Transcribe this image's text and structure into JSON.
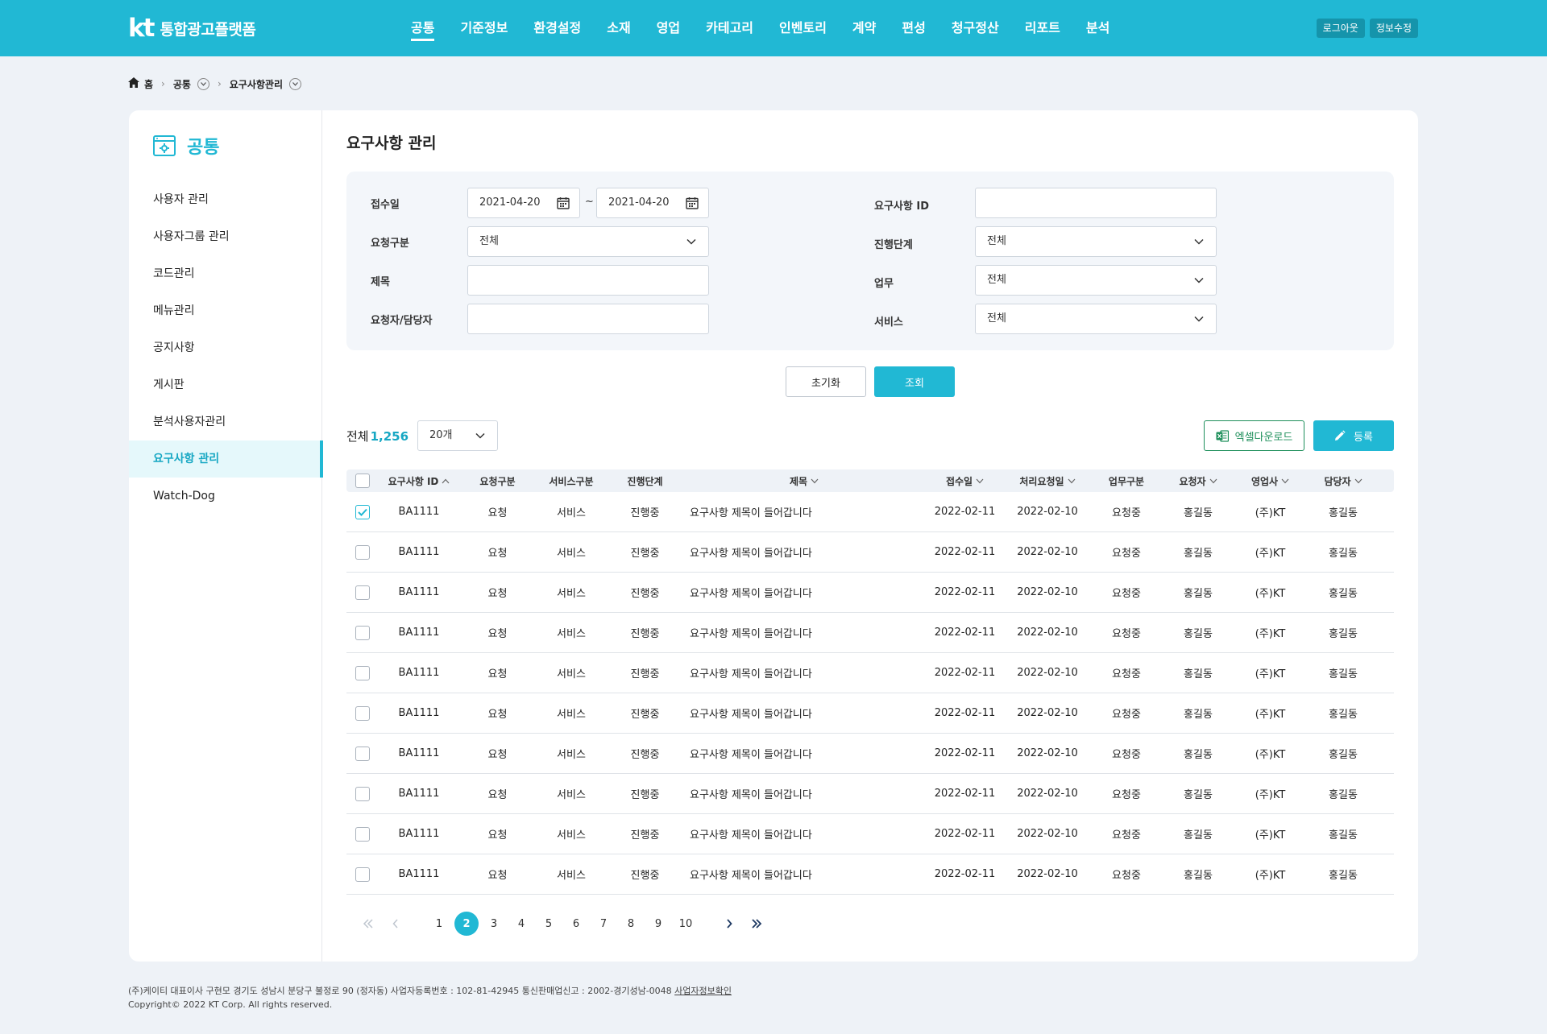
{
  "header": {
    "logo_mark": "kt",
    "logo_name": "통합광고플랫폼",
    "nav": [
      "공통",
      "기준정보",
      "환경설정",
      "소재",
      "영업",
      "카테고리",
      "인벤토리",
      "계약",
      "편성",
      "청구정산",
      "리포트",
      "분석"
    ],
    "logout": "로그아웃",
    "profile_edit": "정보수정",
    "accent_color": "#21b8d4"
  },
  "breadcrumb": {
    "home": "홈",
    "level1": "공통",
    "level2": "요구사항관리"
  },
  "sidebar": {
    "title": "공통",
    "items": [
      "사용자 관리",
      "사용자그룹 관리",
      "코드관리",
      "메뉴관리",
      "공지사항",
      "게시판",
      "분석사용자관리",
      "요구사항 관리",
      "Watch-Dog"
    ],
    "active_index": 7
  },
  "page": {
    "title": "요구사항 관리"
  },
  "search": {
    "received_label": "접수일",
    "date_from": "2021-04-20",
    "date_to": "2021-04-20",
    "tilde": "~",
    "req_id_label": "요구사항 ID",
    "req_id_value": "",
    "req_type_label": "요청구분",
    "req_type_value": "전체",
    "progress_label": "진행단계",
    "progress_value": "전체",
    "subject_label": "제목",
    "subject_value": "",
    "work_label": "업무",
    "work_value": "전체",
    "person_label": "요청자/담당자",
    "person_value": "",
    "service_label": "서비스",
    "service_value": "전체",
    "reset_button": "초기화",
    "search_button": "조회"
  },
  "list": {
    "total_label": "전체",
    "total_count": "1,256",
    "page_size": "20개",
    "excel_button": "엑셀다운로드",
    "register_button": "등록",
    "columns": [
      "요구사항 ID",
      "요청구분",
      "서비스구분",
      "진행단계",
      "제목",
      "접수일",
      "처리요청일",
      "업무구분",
      "요청자",
      "영업사",
      "담당자"
    ],
    "rows": [
      {
        "checked": true,
        "id": "BA1111",
        "req": "요청",
        "svc": "서비스",
        "step": "진행중",
        "title": "요구사항 제목이 들어갑니다",
        "date": "2022-02-11",
        "proc": "2022-02-10",
        "work": "요청중",
        "requester": "홍길동",
        "sales": "(주)KT",
        "manager": "홍길동"
      },
      {
        "checked": false,
        "id": "BA1111",
        "req": "요청",
        "svc": "서비스",
        "step": "진행중",
        "title": "요구사항 제목이 들어갑니다",
        "date": "2022-02-11",
        "proc": "2022-02-10",
        "work": "요청중",
        "requester": "홍길동",
        "sales": "(주)KT",
        "manager": "홍길동"
      },
      {
        "checked": false,
        "id": "BA1111",
        "req": "요청",
        "svc": "서비스",
        "step": "진행중",
        "title": "요구사항 제목이 들어갑니다",
        "date": "2022-02-11",
        "proc": "2022-02-10",
        "work": "요청중",
        "requester": "홍길동",
        "sales": "(주)KT",
        "manager": "홍길동"
      },
      {
        "checked": false,
        "id": "BA1111",
        "req": "요청",
        "svc": "서비스",
        "step": "진행중",
        "title": "요구사항 제목이 들어갑니다",
        "date": "2022-02-11",
        "proc": "2022-02-10",
        "work": "요청중",
        "requester": "홍길동",
        "sales": "(주)KT",
        "manager": "홍길동"
      },
      {
        "checked": false,
        "id": "BA1111",
        "req": "요청",
        "svc": "서비스",
        "step": "진행중",
        "title": "요구사항 제목이 들어갑니다",
        "date": "2022-02-11",
        "proc": "2022-02-10",
        "work": "요청중",
        "requester": "홍길동",
        "sales": "(주)KT",
        "manager": "홍길동"
      },
      {
        "checked": false,
        "id": "BA1111",
        "req": "요청",
        "svc": "서비스",
        "step": "진행중",
        "title": "요구사항 제목이 들어갑니다",
        "date": "2022-02-11",
        "proc": "2022-02-10",
        "work": "요청중",
        "requester": "홍길동",
        "sales": "(주)KT",
        "manager": "홍길동"
      },
      {
        "checked": false,
        "id": "BA1111",
        "req": "요청",
        "svc": "서비스",
        "step": "진행중",
        "title": "요구사항 제목이 들어갑니다",
        "date": "2022-02-11",
        "proc": "2022-02-10",
        "work": "요청중",
        "requester": "홍길동",
        "sales": "(주)KT",
        "manager": "홍길동"
      },
      {
        "checked": false,
        "id": "BA1111",
        "req": "요청",
        "svc": "서비스",
        "step": "진행중",
        "title": "요구사항 제목이 들어갑니다",
        "date": "2022-02-11",
        "proc": "2022-02-10",
        "work": "요청중",
        "requester": "홍길동",
        "sales": "(주)KT",
        "manager": "홍길동"
      },
      {
        "checked": false,
        "id": "BA1111",
        "req": "요청",
        "svc": "서비스",
        "step": "진행중",
        "title": "요구사항 제목이 들어갑니다",
        "date": "2022-02-11",
        "proc": "2022-02-10",
        "work": "요청중",
        "requester": "홍길동",
        "sales": "(주)KT",
        "manager": "홍길동"
      },
      {
        "checked": false,
        "id": "BA1111",
        "req": "요청",
        "svc": "서비스",
        "step": "진행중",
        "title": "요구사항 제목이 들어갑니다",
        "date": "2022-02-11",
        "proc": "2022-02-10",
        "work": "요청중",
        "requester": "홍길동",
        "sales": "(주)KT",
        "manager": "홍길동"
      }
    ]
  },
  "pagination": {
    "pages": [
      "1",
      "2",
      "3",
      "4",
      "5",
      "6",
      "7",
      "8",
      "9",
      "10"
    ],
    "current": "2"
  },
  "footer": {
    "line1": "(주)케이티 대표이사 구현모 경기도 성남시 분당구 불정로 90 (정자동) 사업자등록번호 : 102-81-42945 통신판매업신고 : 2002-경기성남-0048",
    "link": "사업자정보확인",
    "copyright": "Copyright© 2022 KT Corp. All rights reserved."
  }
}
